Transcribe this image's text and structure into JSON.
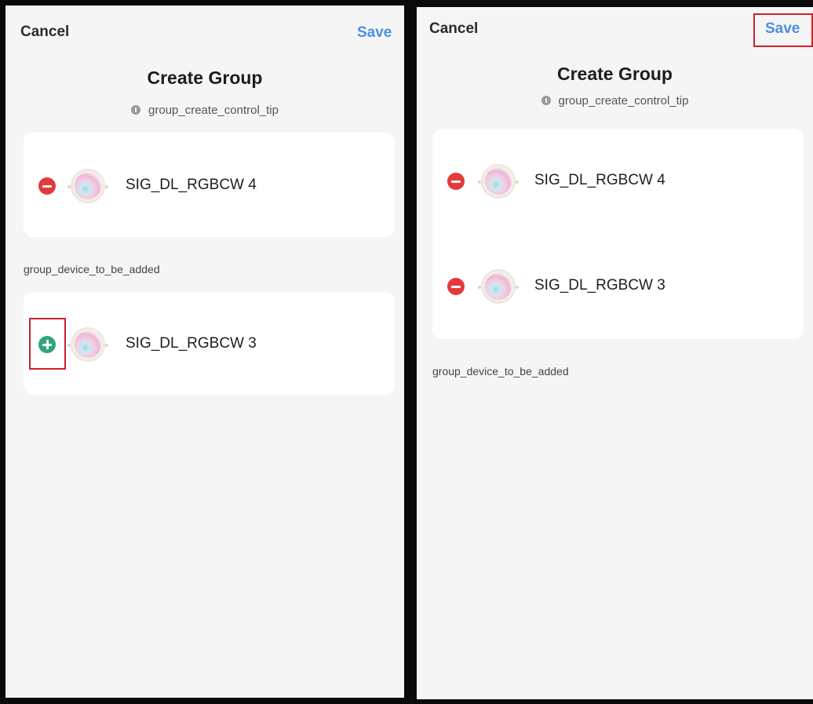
{
  "screens": [
    {
      "nav": {
        "cancel_label": "Cancel",
        "save_label": "Save"
      },
      "title": "Create Group",
      "tip": "group_create_control_tip",
      "group_devices": [
        {
          "name": "SIG_DL_RGBCW 4",
          "action": "remove"
        }
      ],
      "section_label": "group_device_to_be_added",
      "available_devices": [
        {
          "name": "SIG_DL_RGBCW 3",
          "action": "add"
        }
      ],
      "highlighted": "add-button"
    },
    {
      "nav": {
        "cancel_label": "Cancel",
        "save_label": "Save"
      },
      "title": "Create Group",
      "tip": "group_create_control_tip",
      "group_devices": [
        {
          "name": "SIG_DL_RGBCW 4",
          "action": "remove"
        },
        {
          "name": "SIG_DL_RGBCW 3",
          "action": "remove"
        }
      ],
      "section_label": "group_device_to_be_added",
      "available_devices": [],
      "highlighted": "save-button"
    }
  ],
  "colors": {
    "accent": "#4a8fe0",
    "remove": "#e5383b",
    "add": "#2fa57d",
    "highlight": "#c9232b",
    "background": "#f6f5f5",
    "card": "#ffffff"
  }
}
